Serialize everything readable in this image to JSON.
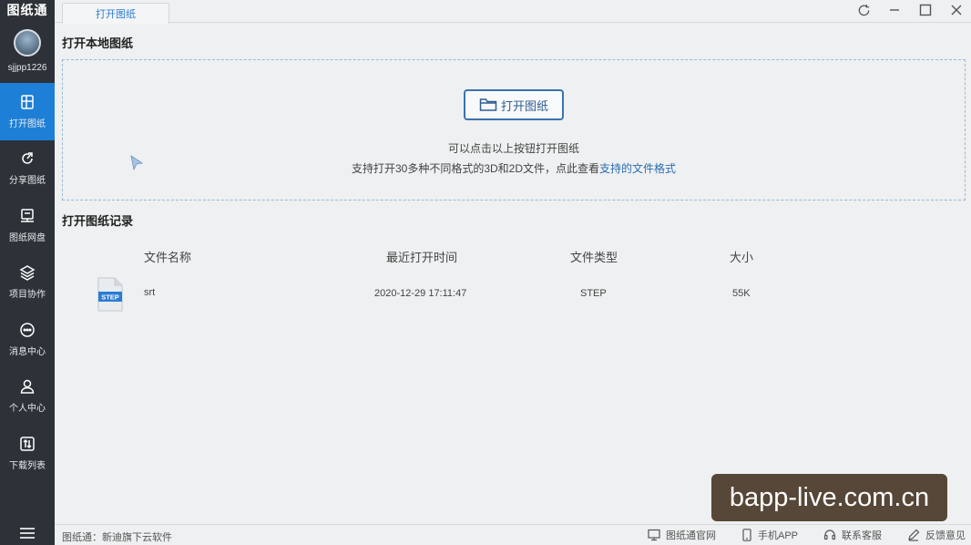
{
  "app": {
    "logo": "图纸通",
    "username": "sjjpp1226"
  },
  "sidebar": {
    "items": [
      {
        "label": "打开图纸",
        "icon": "open-drawing-icon",
        "active": true
      },
      {
        "label": "分享图纸",
        "icon": "share-icon"
      },
      {
        "label": "图纸网盘",
        "icon": "cloud-drive-icon"
      },
      {
        "label": "项目协作",
        "icon": "layers-icon"
      },
      {
        "label": "消息中心",
        "icon": "message-icon"
      },
      {
        "label": "个人中心",
        "icon": "user-icon"
      },
      {
        "label": "下载列表",
        "icon": "download-list-icon"
      }
    ],
    "menu_icon": "hamburger-menu-icon"
  },
  "tabs": [
    {
      "label": "打开图纸"
    }
  ],
  "window_controls": [
    "refresh-icon",
    "minimize-icon",
    "maximize-icon",
    "close-icon"
  ],
  "open_local": {
    "title": "打开本地图纸",
    "button_label": "打开图纸",
    "hint_line1": "可以点击以上按钮打开图纸",
    "hint_line2": "支持打开30多种不同格式的3D和2D文件，点此查看",
    "hint_link": "支持的文件格式"
  },
  "records": {
    "title": "打开图纸记录",
    "columns": [
      "文件名称",
      "最近打开时间",
      "文件类型",
      "大小"
    ],
    "rows": [
      {
        "name": "srt",
        "time": "2020-12-29 17:11:47",
        "type": "STEP",
        "size": "55K",
        "icon_label": "STEP"
      }
    ]
  },
  "status": {
    "left": "图纸通：新迪旗下云软件",
    "links": [
      {
        "label": "图纸通官网",
        "icon": "monitor-icon"
      },
      {
        "label": "手机APP",
        "icon": "phone-icon"
      },
      {
        "label": "联系客服",
        "icon": "headset-icon"
      },
      {
        "label": "反馈意见",
        "icon": "edit-icon"
      }
    ]
  },
  "watermark": "bapp-live.com.cn",
  "colors": {
    "sidebar_bg": "#2d3238",
    "active": "#1e7fd6",
    "link": "#2b6cb0"
  }
}
